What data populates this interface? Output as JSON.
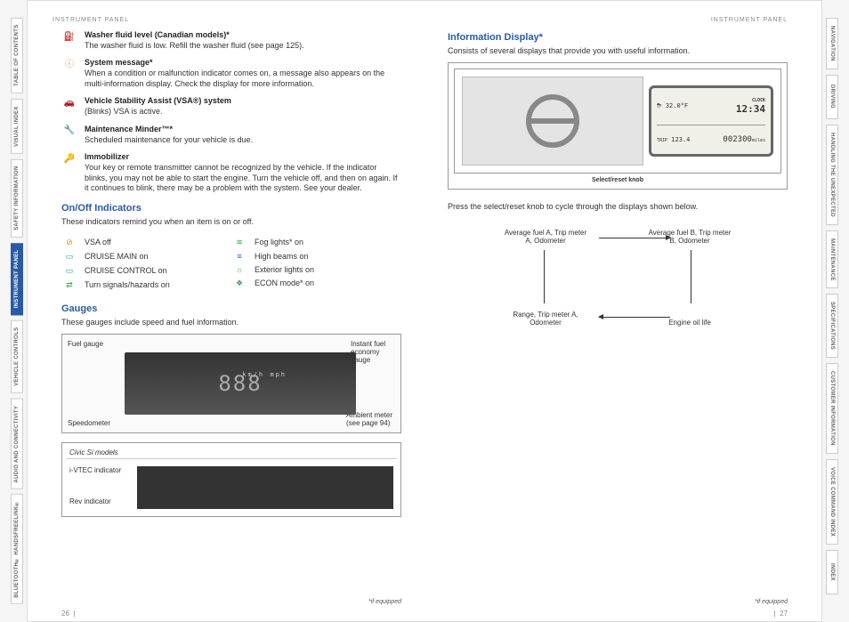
{
  "header": {
    "left": "INSTRUMENT PANEL",
    "right": "INSTRUMENT PANEL"
  },
  "leftTabs": [
    {
      "label": "TABLE OF CONTENTS",
      "active": false
    },
    {
      "label": "VISUAL INDEX",
      "active": false
    },
    {
      "label": "SAFETY INFORMATION",
      "active": false
    },
    {
      "label": "INSTRUMENT PANEL",
      "active": true
    },
    {
      "label": "VEHICLE CONTROLS",
      "active": false
    },
    {
      "label": "AUDIO AND CONNECTIVITY",
      "active": false
    },
    {
      "label": "BLUETOOTH® HANDSFREELINK®",
      "active": false
    }
  ],
  "rightTabs": [
    {
      "label": "NAVIGATION",
      "active": false
    },
    {
      "label": "DRIVING",
      "active": false
    },
    {
      "label": "HANDLING THE UNEXPECTED",
      "active": false
    },
    {
      "label": "MAINTENANCE",
      "active": false
    },
    {
      "label": "SPECIFICATIONS",
      "active": false
    },
    {
      "label": "CUSTOMER INFORMATION",
      "active": false
    },
    {
      "label": "VOICE COMMAND INDEX",
      "active": false
    },
    {
      "label": "INDEX",
      "active": false
    }
  ],
  "indicators": [
    {
      "icon": "washer-fluid-icon",
      "glyph": "⛽",
      "cls": "c-orange",
      "title": "Washer fluid level (Canadian models)*",
      "desc": "The washer fluid is low. Refill the washer fluid (see page 125)."
    },
    {
      "icon": "info-icon",
      "glyph": "ⓘ",
      "cls": "c-orange",
      "title": "System message*",
      "desc": "When a condition or malfunction indicator comes on, a message also appears on the multi-information display. Check the display for more information."
    },
    {
      "icon": "vsa-icon",
      "glyph": "🚗",
      "cls": "c-orange",
      "title": "Vehicle Stability Assist (VSA®) system",
      "desc": "(Blinks) VSA is active."
    },
    {
      "icon": "wrench-icon",
      "glyph": "🔧",
      "cls": "c-orange",
      "title": "Maintenance Minder™*",
      "desc": "Scheduled maintenance for your vehicle is due."
    },
    {
      "icon": "key-icon",
      "glyph": "🔑",
      "cls": "c-green",
      "title": "Immobilizer",
      "desc": "Your key or remote transmitter cannot be recognized by the vehicle. If the indicator blinks, you may not be able to start the engine. Turn the vehicle off, and then on again. If it continues to blink, there may be a problem with the system. See your dealer."
    }
  ],
  "onoff": {
    "heading": "On/Off Indicators",
    "intro": "These indicators remind you when an item is on or off.",
    "left": [
      {
        "icon": "vsa-off-icon",
        "glyph": "⊘",
        "cls": "c-orange",
        "label": "VSA off"
      },
      {
        "icon": "cruise-main-icon",
        "glyph": "▭",
        "cls": "c-teal",
        "label": "CRUISE MAIN on"
      },
      {
        "icon": "cruise-control-icon",
        "glyph": "▭",
        "cls": "c-teal",
        "label": "CRUISE CONTROL on"
      },
      {
        "icon": "turn-signals-icon",
        "glyph": "⇄",
        "cls": "c-green",
        "label": "Turn signals/hazards on"
      }
    ],
    "right": [
      {
        "icon": "fog-lights-icon",
        "glyph": "≋",
        "cls": "c-green",
        "label": "Fog lights* on"
      },
      {
        "icon": "high-beams-icon",
        "glyph": "≡",
        "cls": "c-blue",
        "label": "High beams on"
      },
      {
        "icon": "exterior-lights-icon",
        "glyph": "☼",
        "cls": "c-green",
        "label": "Exterior lights on"
      },
      {
        "icon": "econ-icon",
        "glyph": "❖",
        "cls": "c-green",
        "label": "ECON mode* on"
      }
    ]
  },
  "gauges": {
    "heading": "Gauges",
    "intro": "These gauges include speed and fuel information.",
    "labels": {
      "fuel": "Fuel gauge",
      "speedo": "Speedometer",
      "instant": "Instant fuel economy gauge",
      "ambient": "Ambient meter (see page 94)"
    },
    "readout": "888",
    "units": "km/h mph",
    "civic": {
      "head": "Civic Si models",
      "ivtec": "i-VTEC indicator",
      "rev": "Rev indicator"
    }
  },
  "info": {
    "heading": "Information Display*",
    "intro": "Consists of several displays that provide you with useful information.",
    "knob": "Select/reset knob",
    "lcd": {
      "clockLabel": "CLOCK",
      "temp": "32.0",
      "tempUnit": "°F",
      "time": "12:34",
      "trip": "123.4",
      "tripLabel": "TRIP",
      "odo": "002300",
      "odoUnit": "miles"
    },
    "press": "Press the select/reset knob to cycle through the displays shown below.",
    "cycle": {
      "a": "Average fuel A, Trip meter A, Odometer",
      "b": "Average fuel B, Trip meter B, Odometer",
      "c": "Range, Trip meter A, Odometer",
      "d": "Engine oil life"
    }
  },
  "footnote": "*if equipped",
  "pages": {
    "left": "26",
    "right": "27",
    "sep": "|"
  }
}
